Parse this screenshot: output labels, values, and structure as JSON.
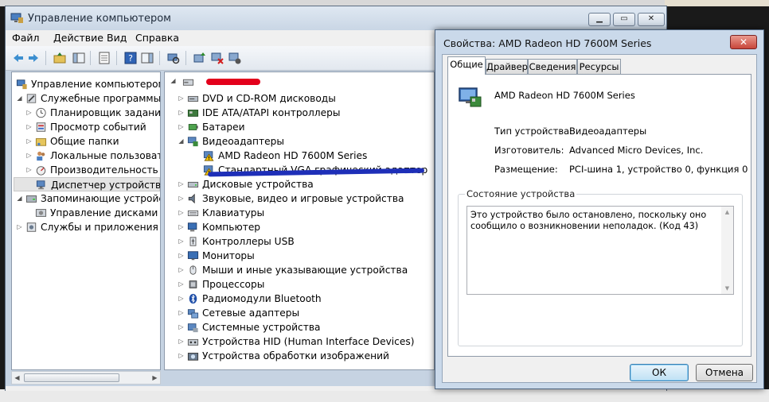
{
  "main_window": {
    "title": "Управление компьютером",
    "menu": [
      "Файл",
      "Действие",
      "Вид",
      "Справка"
    ],
    "tree": [
      {
        "label": "Управление компьютером (л",
        "icon": "computer-management-icon",
        "arrow": ""
      },
      {
        "label": "Служебные программы",
        "icon": "tools-icon",
        "arrow": "◢"
      },
      {
        "label": "Планировщик заданий",
        "icon": "clock-icon",
        "arrow": "▷"
      },
      {
        "label": "Просмотр событий",
        "icon": "event-viewer-icon",
        "arrow": "▷"
      },
      {
        "label": "Общие папки",
        "icon": "shared-folder-icon",
        "arrow": "▷"
      },
      {
        "label": "Локальные пользовате",
        "icon": "users-icon",
        "arrow": "▷"
      },
      {
        "label": "Производительность",
        "icon": "performance-icon",
        "arrow": "▷"
      },
      {
        "label": "Диспетчер устройств",
        "icon": "device-manager-icon",
        "arrow": ""
      },
      {
        "label": "Запоминающие устройст",
        "icon": "storage-icon",
        "arrow": "◢"
      },
      {
        "label": "Управление дисками",
        "icon": "disk-management-icon",
        "arrow": ""
      },
      {
        "label": "Службы и приложения",
        "icon": "services-icon",
        "arrow": "▷"
      }
    ],
    "devices": [
      {
        "label": "DVD и CD-ROM дисководы",
        "icon": "dvd-icon",
        "arrow": "▷"
      },
      {
        "label": "IDE ATA/ATAPI контроллеры",
        "icon": "ide-controller-icon",
        "arrow": "▷"
      },
      {
        "label": "Батареи",
        "icon": "battery-icon",
        "arrow": "▷"
      },
      {
        "label": "Видеоадаптеры",
        "icon": "display-adapter-icon",
        "arrow": "◢"
      },
      {
        "label": "AMD Radeon HD 7600M Series",
        "icon": "warning-adapter-icon",
        "arrow": ""
      },
      {
        "label": "Стандартный VGA графический адаптер",
        "icon": "warning-adapter-icon",
        "arrow": ""
      },
      {
        "label": "Дисковые устройства",
        "icon": "disk-drive-icon",
        "arrow": "▷"
      },
      {
        "label": "Звуковые, видео и игровые устройства",
        "icon": "sound-icon",
        "arrow": "▷"
      },
      {
        "label": "Клавиатуры",
        "icon": "keyboard-icon",
        "arrow": "▷"
      },
      {
        "label": "Компьютер",
        "icon": "computer-icon",
        "arrow": "▷"
      },
      {
        "label": "Контроллеры USB",
        "icon": "usb-icon",
        "arrow": "▷"
      },
      {
        "label": "Мониторы",
        "icon": "monitor-icon",
        "arrow": "▷"
      },
      {
        "label": "Мыши и иные указывающие устройства",
        "icon": "mouse-icon",
        "arrow": "▷"
      },
      {
        "label": "Процессоры",
        "icon": "processor-icon",
        "arrow": "▷"
      },
      {
        "label": "Радиомодули Bluetooth",
        "icon": "bluetooth-icon",
        "arrow": "▷"
      },
      {
        "label": "Сетевые адаптеры",
        "icon": "network-icon",
        "arrow": "▷"
      },
      {
        "label": "Системные устройства",
        "icon": "system-device-icon",
        "arrow": "▷"
      },
      {
        "label": "Устройства HID (Human Interface Devices)",
        "icon": "hid-icon",
        "arrow": "▷"
      },
      {
        "label": "Устройства обработки изображений",
        "icon": "imaging-icon",
        "arrow": "▷"
      }
    ]
  },
  "dialog": {
    "title": "Свойства: AMD Radeon HD 7600M Series",
    "close_label": "✕",
    "tabs": [
      "Общие",
      "Драйвер",
      "Сведения",
      "Ресурсы"
    ],
    "device_name": "AMD Radeon HD 7600M Series",
    "properties": [
      {
        "label": "Тип устройства:",
        "value": "Видеоадаптеры"
      },
      {
        "label": "Изготовитель:",
        "value": "Advanced Micro Devices, Inc."
      },
      {
        "label": "Размещение:",
        "value": "PCI-шина 1, устройство 0, функция 0"
      }
    ],
    "status_group_label": "Состояние устройства",
    "status_text": "Это устройство было остановлено, поскольку оно сообщило о возникновении неполадок. (Код 43)",
    "ok_label": "ОК",
    "cancel_label": "Отмена"
  },
  "colors": {
    "redaction": "#e3001b",
    "annotation_line": "#1e2fb8",
    "warning": "#f2c200"
  }
}
